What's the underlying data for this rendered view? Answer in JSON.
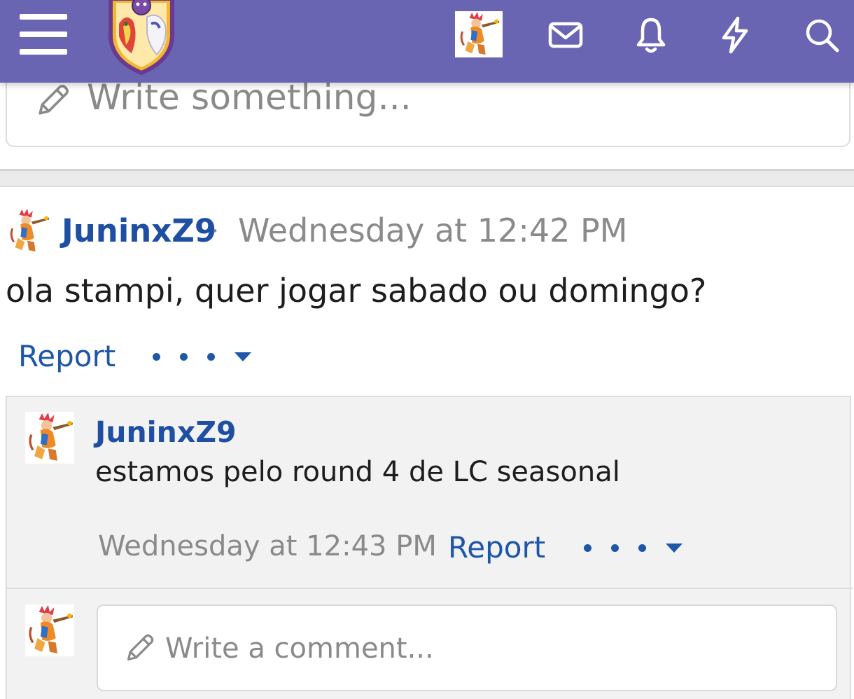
{
  "header": {
    "menu_icon": "hamburger-menu-icon",
    "logo_icon": "site-crest-logo",
    "user_avatar_icon": "user-avatar",
    "icons": [
      "mail-icon",
      "bell-icon",
      "lightning-icon",
      "search-icon"
    ],
    "color": "#6a65b3"
  },
  "composer": {
    "placeholder": "Write something..."
  },
  "post": {
    "author": "JuninxZ9",
    "separator": "·",
    "time": "Wednesday at 12:42 PM",
    "body": "ola stampi, quer jogar sabado ou domingo?",
    "report_label": "Report"
  },
  "comment": {
    "author": "JuninxZ9",
    "body": "estamos pelo round 4 de LC seasonal",
    "time": "Wednesday at 12:43 PM",
    "report_label": "Report"
  },
  "reply": {
    "placeholder": "Write a comment..."
  },
  "colors": {
    "link": "#1e56a8",
    "muted": "#8a8a8a",
    "panel": "#f2f2f2"
  }
}
